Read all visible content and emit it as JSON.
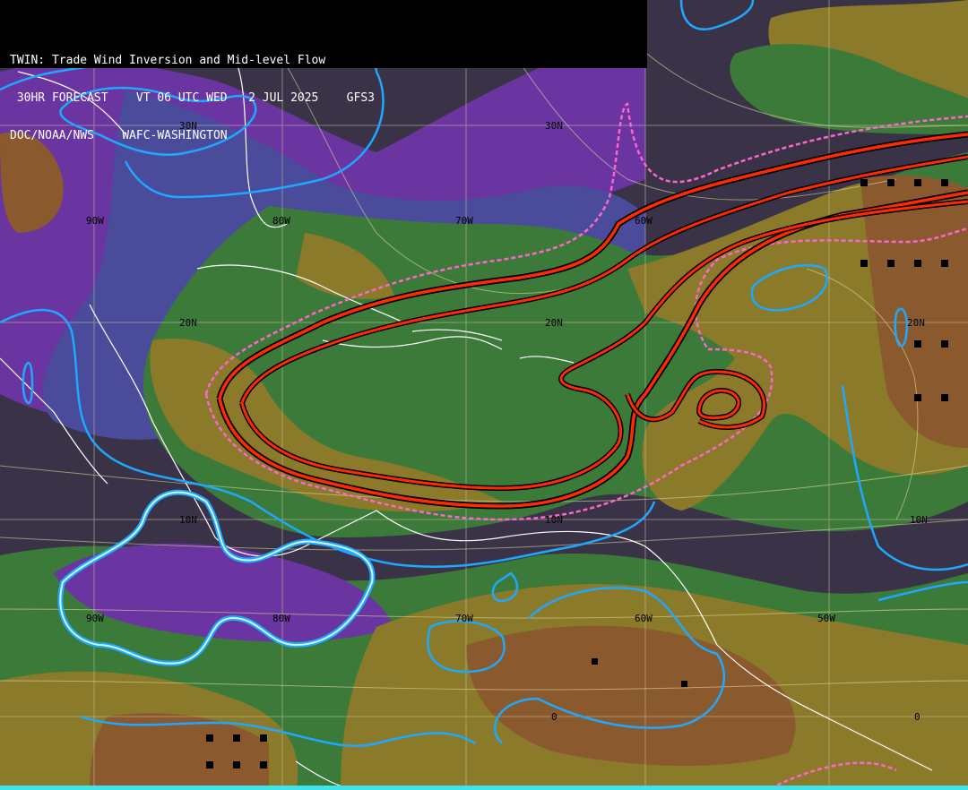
{
  "header": {
    "line1": "TWIN: Trade Wind Inversion and Mid-level Flow",
    "line2": " 30HR FORECAST    VT 06 UTC WED   2 JUL 2025    GFS3",
    "line3": "DOC/NOAA/NWS    WAFC-WASHINGTON"
  },
  "grid_labels": {
    "lat": [
      "30N",
      "20N",
      "10N",
      "0"
    ],
    "lon": [
      "90W",
      "80W",
      "70W",
      "60W",
      "50W"
    ]
  },
  "colors": {
    "background": "#3a3347",
    "purple": "#7a3bb0",
    "blue": "#4a4a9a",
    "green": "#3f7a3a",
    "olive": "#8a7a2a",
    "brown": "#8a5a2e",
    "streamlines": "#e8e0a0",
    "inversion_red": "#ff2a00",
    "inversion_dashed": "#ff66cc",
    "cyan_contour": "#1ea8ff",
    "coastline": "#ffffff",
    "bottom_bar": "#3fe3ea"
  }
}
